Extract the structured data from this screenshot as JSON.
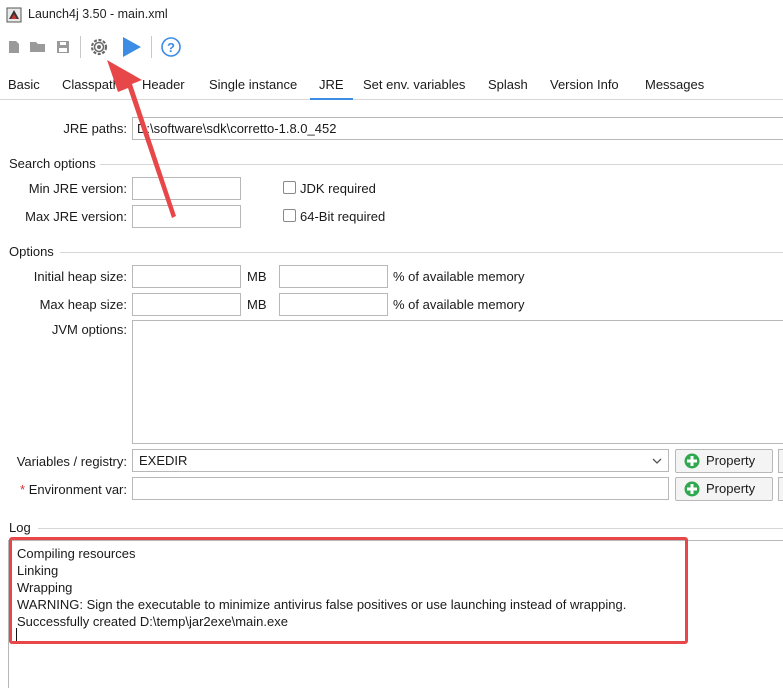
{
  "window": {
    "title": "Launch4j 3.50 - main.xml"
  },
  "toolbar": {
    "icons": [
      "new-file-icon",
      "open-folder-icon",
      "save-icon",
      "build-gear-icon",
      "run-play-icon",
      "help-icon"
    ]
  },
  "tabs": [
    {
      "label": "Basic",
      "active": false
    },
    {
      "label": "Classpath",
      "active": false
    },
    {
      "label": "Header",
      "active": false
    },
    {
      "label": "Single instance",
      "active": false
    },
    {
      "label": "JRE",
      "active": true
    },
    {
      "label": "Set env. variables",
      "active": false
    },
    {
      "label": "Splash",
      "active": false
    },
    {
      "label": "Version Info",
      "active": false
    },
    {
      "label": "Messages",
      "active": false
    }
  ],
  "jre": {
    "paths_label": "JRE paths:",
    "paths_value": "D:\\software\\sdk\\corretto-1.8.0_452"
  },
  "search_options": {
    "title": "Search options",
    "min_label": "Min JRE version:",
    "min_value": "",
    "max_label": "Max JRE version:",
    "max_value": "",
    "jdk_required": "JDK required",
    "bit64_required": "64-Bit required"
  },
  "options": {
    "title": "Options",
    "initial_heap_label": "Initial heap size:",
    "max_heap_label": "Max heap size:",
    "mb": "MB",
    "percent_label": "% of available memory",
    "jvm_label": "JVM options:",
    "variables_label": "Variables / registry:",
    "variables_value": "EXEDIR",
    "env_star": "*",
    "env_label": "Environment var:",
    "env_value": "",
    "property_button": "Property"
  },
  "log": {
    "title": "Log",
    "lines": [
      "Compiling resources",
      "Linking",
      "Wrapping",
      "WARNING: Sign the executable to minimize antivirus false positives or use launching instead of wrapping.",
      "Successfully created D:\\temp\\jar2exe\\main.exe"
    ]
  },
  "colors": {
    "annotation_red": "#e8474a",
    "accent_blue": "#3c8ce6",
    "plus_green": "#2fa84f"
  }
}
